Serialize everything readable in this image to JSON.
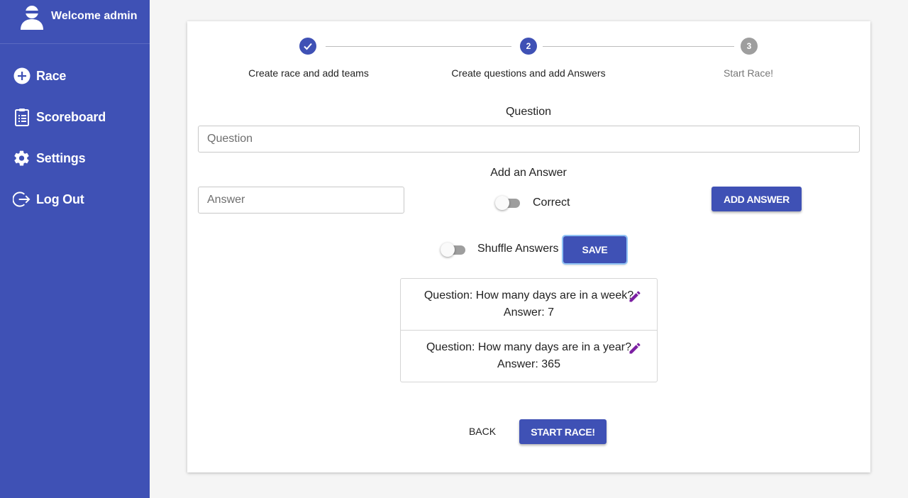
{
  "sidebar": {
    "welcome": "Welcome admin",
    "items": [
      {
        "label": "Race",
        "icon": "add-circle-icon"
      },
      {
        "label": "Scoreboard",
        "icon": "clipboard-icon"
      },
      {
        "label": "Settings",
        "icon": "gear-icon"
      },
      {
        "label": "Log Out",
        "icon": "logout-icon"
      }
    ]
  },
  "stepper": {
    "steps": [
      {
        "number": "",
        "label": "Create race and add teams",
        "state": "completed"
      },
      {
        "number": "2",
        "label": "Create questions and add Answers",
        "state": "active"
      },
      {
        "number": "3",
        "label": "Start Race!",
        "state": "inactive"
      }
    ]
  },
  "form": {
    "question_title": "Question",
    "question_placeholder": "Question",
    "answer_title": "Add an Answer",
    "answer_placeholder": "Answer",
    "correct_label": "Correct",
    "add_answer_label": "ADD ANSWER",
    "shuffle_label": "Shuffle Answers",
    "save_label": "SAVE"
  },
  "questions": [
    {
      "question": "Question: How many days are in a week?",
      "answer": "Answer: 7"
    },
    {
      "question": "Question: How many days are in a year?",
      "answer": "Answer: 365"
    }
  ],
  "actions": {
    "back_label": "BACK",
    "start_label": "START RACE!"
  },
  "colors": {
    "primary": "#3f51b5",
    "edit_icon": "#7b1fa2",
    "inactive_step": "#9e9e9e"
  }
}
